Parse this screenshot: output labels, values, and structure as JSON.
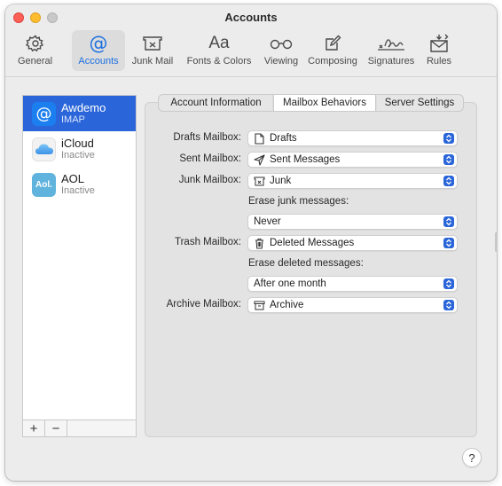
{
  "window": {
    "title": "Accounts"
  },
  "toolbar": {
    "items": [
      {
        "label": "General",
        "icon": "gear-icon"
      },
      {
        "label": "Accounts",
        "icon": "at-icon",
        "active": true
      },
      {
        "label": "Junk Mail",
        "icon": "junk-tray-icon"
      },
      {
        "label": "Fonts & Colors",
        "icon": "aa-icon",
        "glyph": "Aa"
      },
      {
        "label": "Viewing",
        "icon": "glasses-icon"
      },
      {
        "label": "Composing",
        "icon": "compose-icon"
      },
      {
        "label": "Signatures",
        "icon": "signature-icon"
      },
      {
        "label": "Rules",
        "icon": "rules-envelope-icon"
      }
    ]
  },
  "accounts": [
    {
      "name": "Awdemo",
      "status": "IMAP",
      "icon": "at-icon",
      "selected": true,
      "color": "#2a66d9"
    },
    {
      "name": "iCloud",
      "status": "Inactive",
      "icon": "icloud-icon"
    },
    {
      "name": "AOL",
      "status": "Inactive",
      "icon": "aol-icon",
      "glyph": "Aol.",
      "color": "#5fb3dc"
    }
  ],
  "list_footer": {
    "add": "+",
    "remove": "−"
  },
  "tabs": [
    {
      "label": "Account Information"
    },
    {
      "label": "Mailbox Behaviors",
      "active": true
    },
    {
      "label": "Server Settings"
    }
  ],
  "form": {
    "drafts": {
      "label": "Drafts Mailbox:",
      "value": "Drafts",
      "icon": "document-icon"
    },
    "sent": {
      "label": "Sent Mailbox:",
      "value": "Sent Messages",
      "icon": "paperplane-icon"
    },
    "junk": {
      "label": "Junk Mailbox:",
      "value": "Junk",
      "icon": "junk-tray-icon"
    },
    "erase_junk_label": "Erase junk messages:",
    "erase_junk": {
      "value": "Never"
    },
    "trash": {
      "label": "Trash Mailbox:",
      "value": "Deleted Messages",
      "icon": "trash-icon"
    },
    "erase_deleted_label": "Erase deleted messages:",
    "erase_deleted": {
      "value": "After one month"
    },
    "archive": {
      "label": "Archive Mailbox:",
      "value": "Archive",
      "icon": "archive-box-icon"
    }
  },
  "help": {
    "label": "?"
  },
  "colors": {
    "accent": "#1b6fe0",
    "selection": "#2a66d9",
    "close": "#fe5f57",
    "minimize": "#febc2e"
  }
}
